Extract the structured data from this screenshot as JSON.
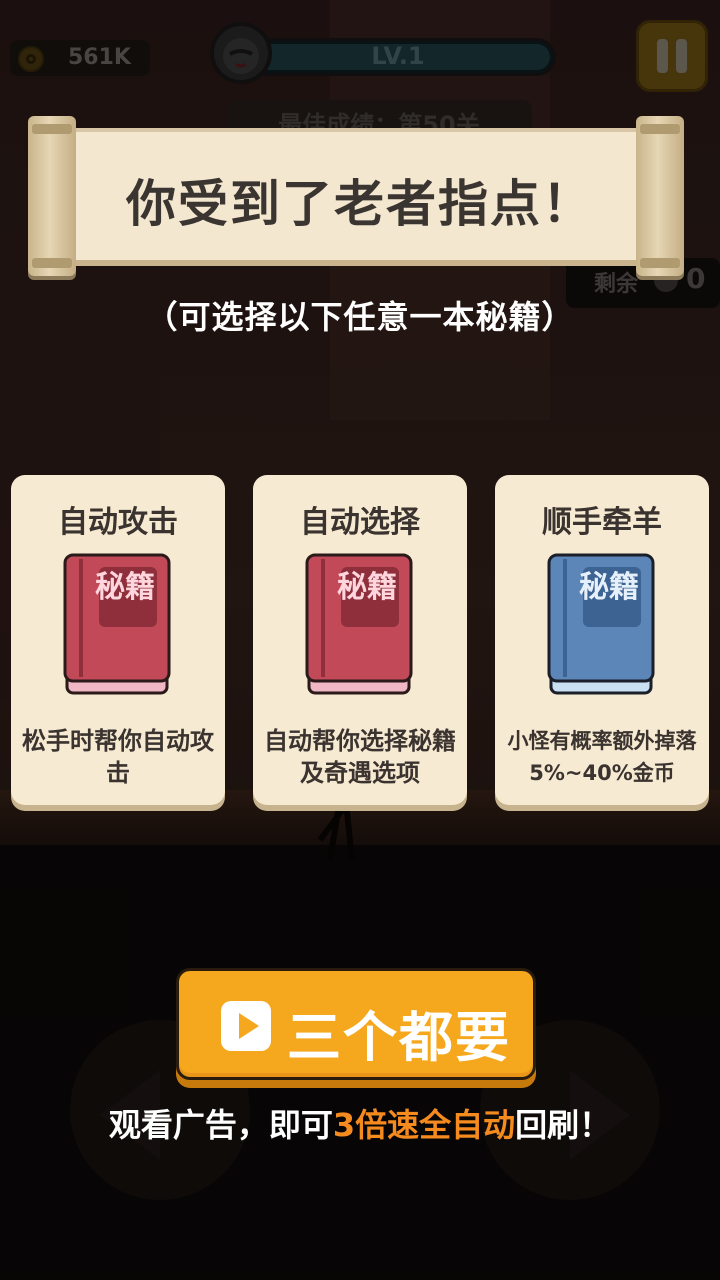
{
  "hud": {
    "coins": "561K",
    "level": "LV.1",
    "best_score": "最佳成绩：第50关",
    "stage_partial": "0关",
    "remaining_label": "剩余",
    "remaining_value": "0"
  },
  "banner": {
    "title": "你受到了老者指点！",
    "subtitle": "（可选择以下任意一本秘籍）"
  },
  "cards": [
    {
      "title": "自动攻击",
      "book_text": "秘籍",
      "book_color": "#c24a58",
      "desc": "松手时帮你自动攻击"
    },
    {
      "title": "自动选择",
      "book_text": "秘籍",
      "book_color": "#c24a58",
      "desc": "自动帮你选择秘籍及奇遇选项"
    },
    {
      "title": "顺手牵羊",
      "book_text": "秘籍",
      "book_color": "#5d86b8",
      "desc": "小怪有概率额外掉落5%~40%金币"
    }
  ],
  "action": {
    "button_label": "三个都要",
    "hint_prefix": "观看广告，即可",
    "hint_highlight": "3倍速全自动",
    "hint_suffix": "回刷！"
  },
  "colors": {
    "accent": "#f5a81e",
    "highlight": "#f58a1e",
    "card_bg": "#f7ead2"
  }
}
